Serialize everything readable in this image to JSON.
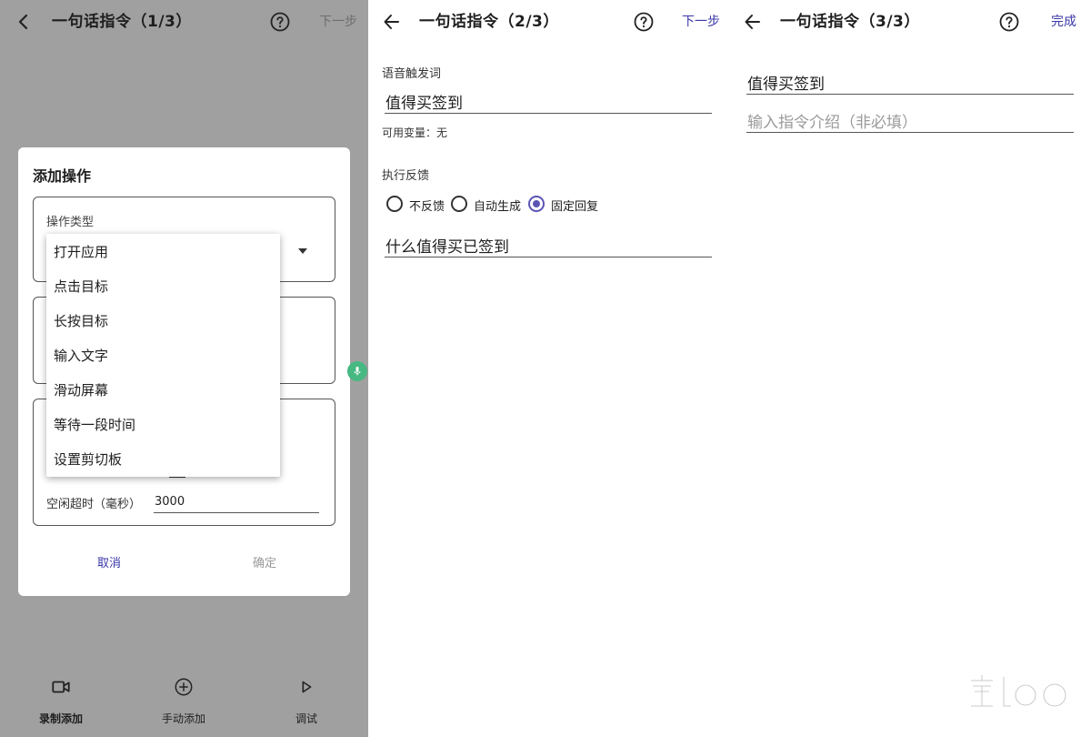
{
  "panel1": {
    "title": "一句话指令（1/3）",
    "next_label": "下一步",
    "dialog": {
      "title": "添加操作",
      "type_label": "操作类型",
      "timeout_label": "空闲超时（毫秒）",
      "timeout_value": "3000",
      "cancel_label": "取消",
      "ok_label": "确定"
    },
    "menu_items": [
      "打开应用",
      "点击目标",
      "长按目标",
      "输入文字",
      "滑动屏幕",
      "等待一段时间",
      "设置剪切板"
    ],
    "bottom_nav": [
      {
        "label": "录制添加",
        "icon": "video-camera-icon",
        "active": true
      },
      {
        "label": "手动添加",
        "icon": "plus-circle-icon",
        "active": false
      },
      {
        "label": "调试",
        "icon": "play-icon",
        "active": false
      }
    ]
  },
  "panel2": {
    "title": "一句话指令（2/3）",
    "next_label": "下一步",
    "trigger_label": "语音触发词",
    "trigger_value": "值得买签到",
    "variables_text": "可用变量：无",
    "feedback_label": "执行反馈",
    "feedback_options": [
      {
        "label": "不反馈",
        "selected": false
      },
      {
        "label": "自动生成",
        "selected": false
      },
      {
        "label": "固定回复",
        "selected": true
      }
    ],
    "reply_value": "什么值得买已签到"
  },
  "panel3": {
    "title": "一句话指令（3/3）",
    "done_label": "完成",
    "name_value": "值得买签到",
    "intro_placeholder": "输入指令介绍（非必填）"
  },
  "colors": {
    "accent": "#3a37a8",
    "radio_accent": "#5a55b5",
    "dim_background": "#a0a0a0",
    "mic_fab": "#47b881"
  }
}
